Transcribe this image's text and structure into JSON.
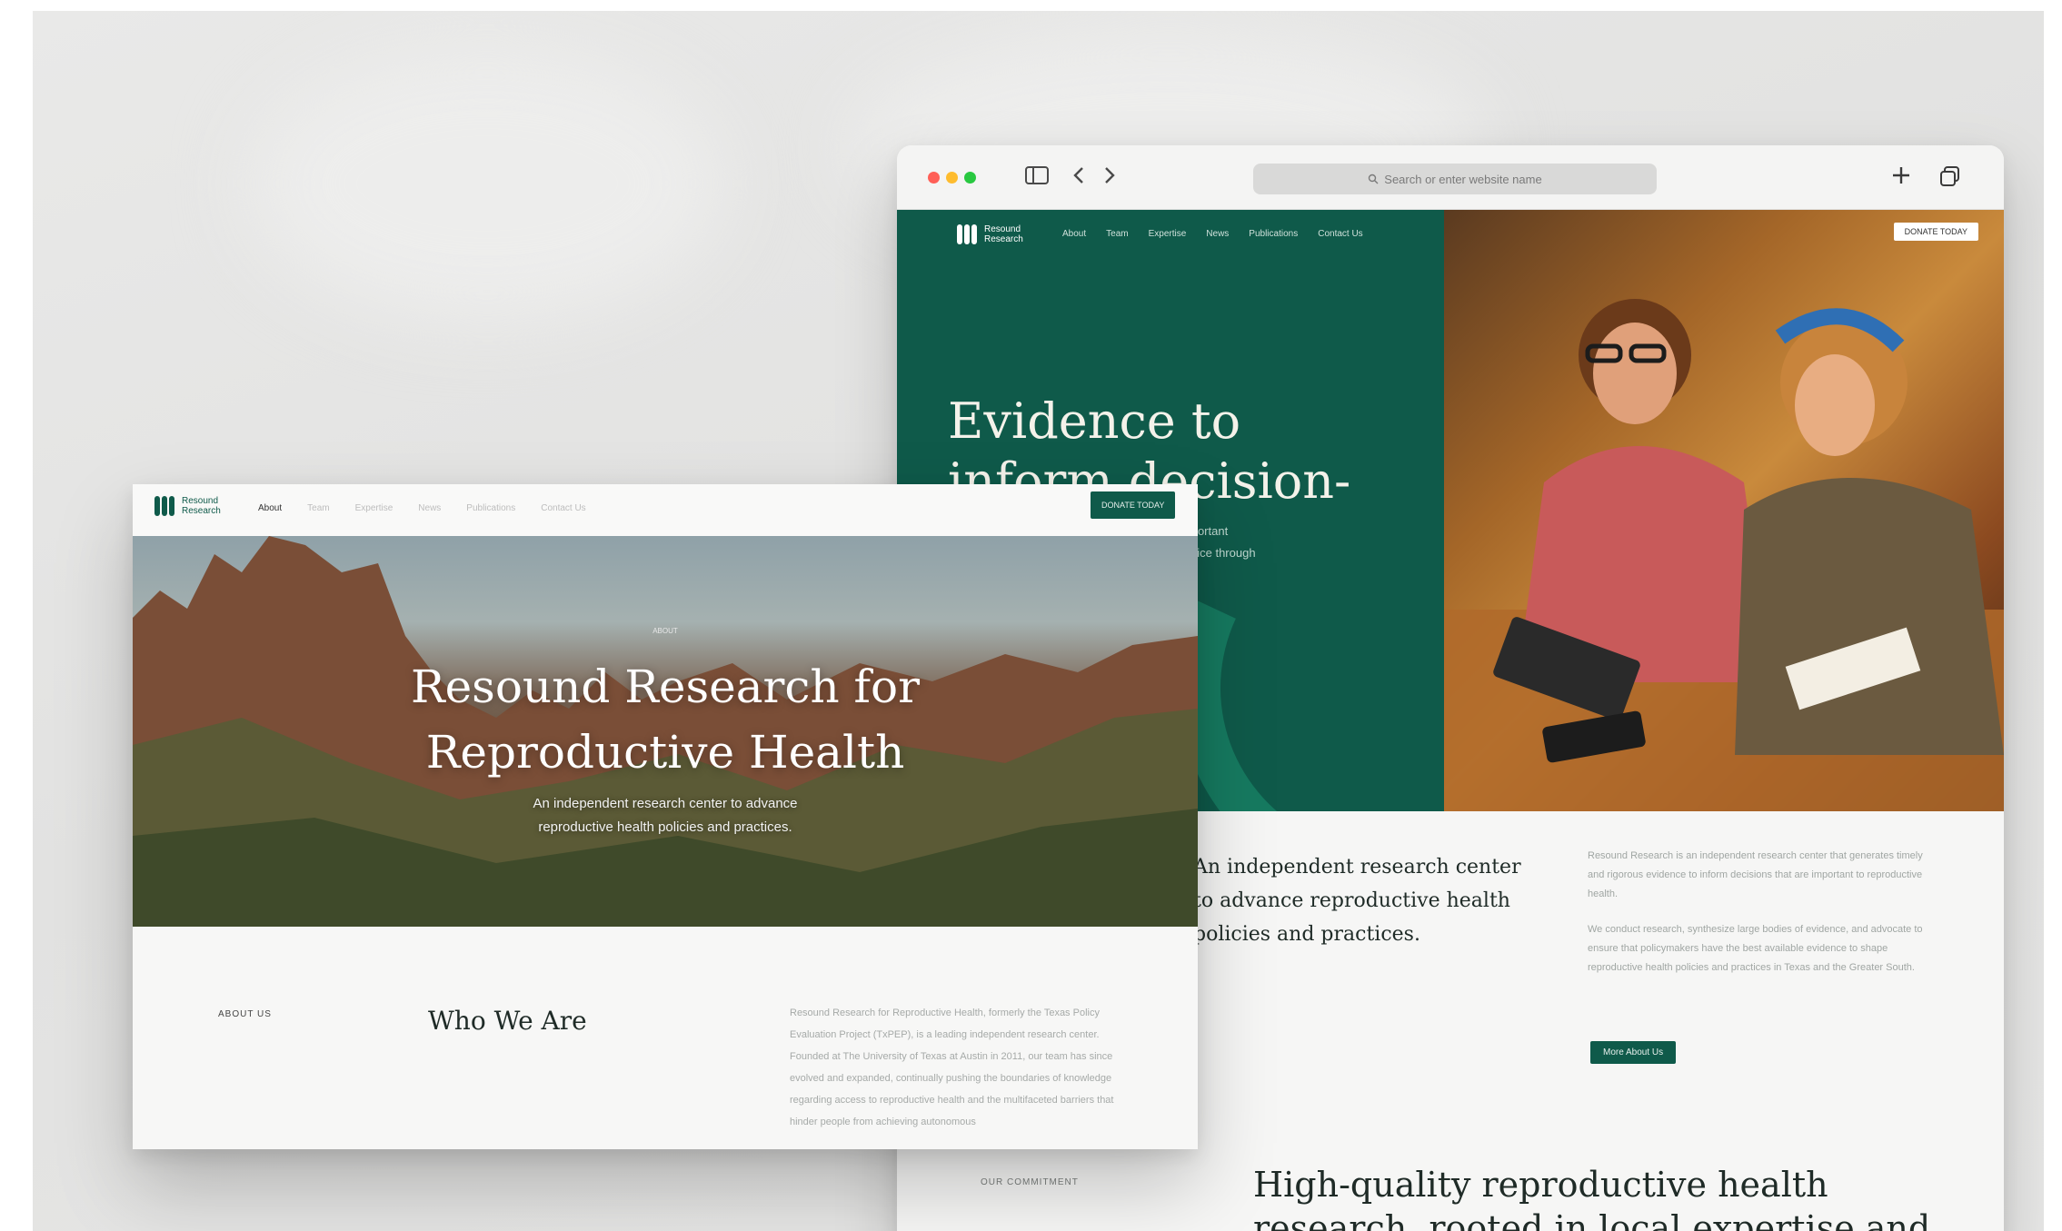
{
  "right_window": {
    "url_placeholder": "Search or enter website name",
    "brand": {
      "line1": "Resound",
      "line2": "Research"
    },
    "nav": [
      "About",
      "Team",
      "Expertise",
      "News",
      "Publications",
      "Contact Us"
    ],
    "donate_label": "DONATE TODAY",
    "hero_title": "Evidence to inform decision-making",
    "hero_sub_line1": "important",
    "hero_sub_line2": "justice through",
    "intro_lead": "An independent research center to advance reproductive health policies and practices.",
    "intro_body_1": "Resound Research is an independent research center that generates timely and rigorous evidence to inform decisions that are important to reproductive health.",
    "intro_body_2": "We conduct research, synthesize large bodies of evidence, and advocate to ensure that policymakers have the best available evidence to shape reproductive health policies and practices in Texas and the Greater South.",
    "learn_more_label": "More About Us",
    "commitment_label": "OUR COMMITMENT",
    "commitment_title": "High-quality reproductive health research, rooted in local expertise and"
  },
  "left_window": {
    "brand": {
      "line1": "Resound",
      "line2": "Research"
    },
    "nav": [
      "About",
      "Team",
      "Expertise",
      "News",
      "Publications",
      "Contact Us"
    ],
    "donate_label": "DONATE TODAY",
    "hero_eyebrow": "ABOUT",
    "hero_title_line1": "Resound Research for",
    "hero_title_line2": "Reproductive Health",
    "hero_sub_line1": "An independent research center to advance",
    "hero_sub_line2": "reproductive health policies and practices.",
    "about_label": "ABOUT US",
    "who_title": "Who We Are",
    "who_body": "Resound Research for Reproductive Health, formerly the Texas Policy Evaluation Project (TxPEP), is a leading independent research center. Founded at The University of Texas at Austin in 2011, our team has since evolved and expanded, continually pushing the boundaries of knowledge regarding access to reproductive health and the multifaceted barriers that hinder people from achieving autonomous"
  },
  "colors": {
    "brand_green": "#0f5a4a",
    "swirl_green": "#167a60",
    "traffic_red": "#ff5f57",
    "traffic_yellow": "#febc2e",
    "traffic_green": "#28c840"
  },
  "icons": [
    "sidebar-icon",
    "back-icon",
    "forward-icon",
    "search-icon",
    "plus-icon",
    "tabs-icon"
  ]
}
